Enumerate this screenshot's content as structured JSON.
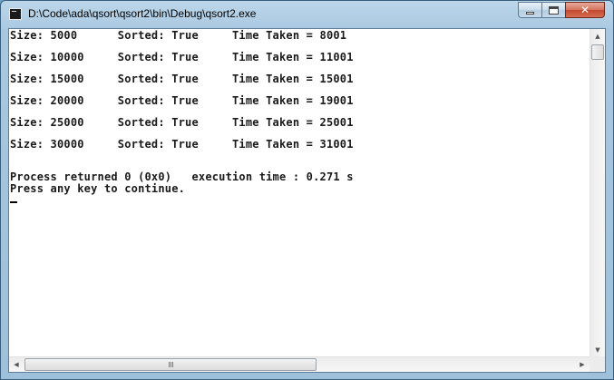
{
  "window": {
    "title": "D:\\Code\\ada\\qsort\\qsort2\\bin\\Debug\\qsort2.exe",
    "icon": "console-app-icon"
  },
  "caption_buttons": {
    "minimize_icon": "minimize-icon",
    "maximize_icon": "maximize-icon",
    "close_icon": "close-icon",
    "close_glyph": "✕"
  },
  "console": {
    "lines": [
      "Size: 5000      Sorted: True     Time Taken = 8001",
      "Size: 10000     Sorted: True     Time Taken = 11001",
      "Size: 15000     Sorted: True     Time Taken = 15001",
      "Size: 20000     Sorted: True     Time Taken = 19001",
      "Size: 25000     Sorted: True     Time Taken = 25001",
      "Size: 30000     Sorted: True     Time Taken = 31001",
      "Process returned 0 (0x0)   execution time : 0.271 s",
      "Press any key to continue."
    ],
    "text_color": "#1a1a1a",
    "background": "#ffffff"
  },
  "scrollbars": {
    "up_glyph": "▲",
    "down_glyph": "▼",
    "left_glyph": "◀",
    "right_glyph": "▶"
  }
}
